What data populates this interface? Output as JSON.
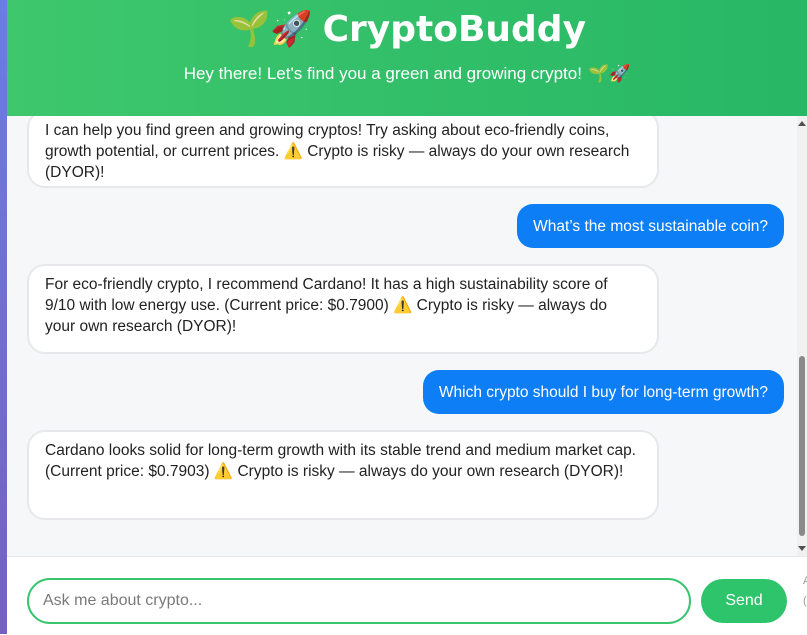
{
  "header": {
    "title_emoji": "🌱🚀",
    "title": "CryptoBuddy",
    "subtitle": "Hey there! Let's find you a green and growing crypto!",
    "subtitle_emoji": "🌱🚀"
  },
  "messages": [
    {
      "role": "bot",
      "text": "I can help you find green and growing cryptos! Try asking about eco-friendly coins, growth potential, or current prices. ⚠️ Crypto is risky — always do your own research (DYOR)!"
    },
    {
      "role": "user",
      "text": "What’s the most sustainable coin?"
    },
    {
      "role": "bot",
      "text": "For eco-friendly crypto, I recommend Cardano! It has a high sustainability score of 9/10 with low energy use. (Current price: $0.7900) ⚠️ Crypto is risky — always do your own research (DYOR)!"
    },
    {
      "role": "user",
      "text": "Which crypto should I buy for long-term growth?"
    },
    {
      "role": "bot",
      "text": "Cardano looks solid for long-term growth with its stable trend and medium market cap. (Current price: $0.7903) ⚠️ Crypto is risky — always do your own research (DYOR)!"
    }
  ],
  "input": {
    "placeholder": "Ask me about crypto...",
    "value": ""
  },
  "send_label": "Send",
  "edge_text": [
    "A",
    "("
  ],
  "colors": {
    "header_green": "#3ec76d",
    "user_bubble": "#0d7ef6",
    "send_button": "#2ec46b"
  }
}
